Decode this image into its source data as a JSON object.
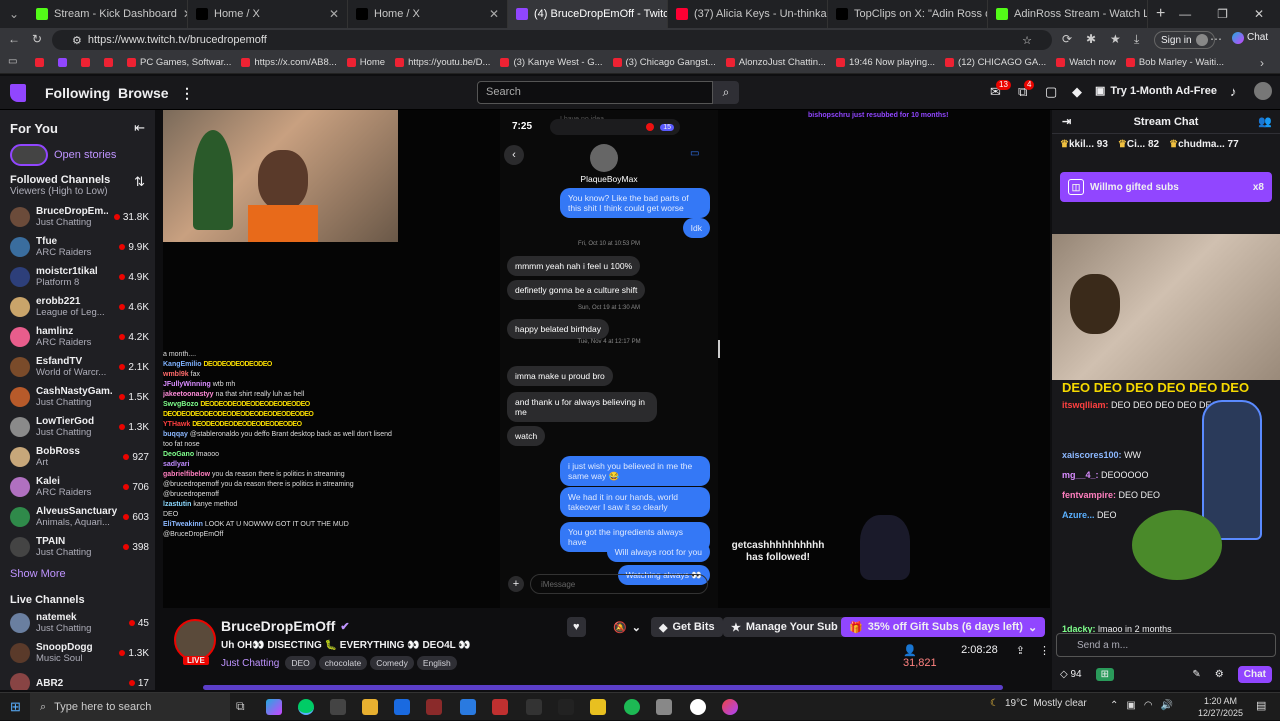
{
  "browser": {
    "tabs": [
      {
        "label": "Stream - Kick Dashboard",
        "color": "#53fc18"
      },
      {
        "label": "Home / X",
        "color": "#000000"
      },
      {
        "label": "Home / X",
        "color": "#000000"
      },
      {
        "label": "(4) BruceDropEmOff - Twitch",
        "color": "#9146ff"
      },
      {
        "label": "(37) Alicia Keys - Un-thinkable (I'm",
        "color": "#ff0033"
      },
      {
        "label": "TopClips on X: \"Adin Ross defends",
        "color": "#000000"
      },
      {
        "label": "AdinRoss Stream - Watch Live on",
        "color": "#53fc18"
      }
    ],
    "url": "https://www.twitch.tv/brucedropemoff",
    "signin": "Sign in",
    "chat_btn": "Chat",
    "bookmarks": [
      "PC Games, Softwar...",
      "https://x.com/AB8...",
      "Home",
      "https://youtu.be/D...",
      "(3) Kanye West - G...",
      "(3) Chicago Gangst...",
      "AlonzoJust Chattin...",
      "19:46 Now playing...",
      "(12) CHICAGO GA...",
      "Watch now",
      "Bob Marley - Waiti..."
    ]
  },
  "twitch": {
    "nav": {
      "following": "Following",
      "browse": "Browse",
      "search_placeholder": "Search",
      "notif1": "13",
      "notif2": "4",
      "adfree": "Try 1-Month Ad-Free"
    },
    "sidebar": {
      "for_you": "For You",
      "open_stories": "Open stories",
      "followed_title": "Followed Channels",
      "followed_sub": "Viewers (High to Low)",
      "channels": [
        {
          "name": "BruceDropEm...",
          "cat": "Just Chatting",
          "viewers": "31.8K",
          "color": "#6b4b3a"
        },
        {
          "name": "Tfue",
          "cat": "ARC Raiders",
          "viewers": "9.9K",
          "color": "#3a6d9e"
        },
        {
          "name": "moistcr1tikal",
          "cat": "Platform 8",
          "viewers": "4.9K",
          "color": "#2d3f7a"
        },
        {
          "name": "erobb221",
          "cat": "League of Leg...",
          "viewers": "4.6K",
          "color": "#c9a46a"
        },
        {
          "name": "hamlinz",
          "cat": "ARC Raiders",
          "viewers": "4.2K",
          "color": "#e85d8c"
        },
        {
          "name": "EsfandTV",
          "cat": "World of Warcr...",
          "viewers": "2.1K",
          "color": "#7a4b2a"
        },
        {
          "name": "CashNastyGam...",
          "cat": "Just Chatting",
          "viewers": "1.5K",
          "color": "#b75a2a"
        },
        {
          "name": "LowTierGod",
          "cat": "Just Chatting",
          "viewers": "1.3K",
          "color": "#8a8a8a"
        },
        {
          "name": "BobRoss",
          "cat": "Art",
          "viewers": "927",
          "color": "#c7a77a"
        },
        {
          "name": "Kalei",
          "cat": "ARC Raiders",
          "viewers": "706",
          "color": "#b070c0"
        },
        {
          "name": "AlveusSanctuary",
          "cat": "Animals, Aquari...",
          "viewers": "603",
          "color": "#2f8a4a"
        },
        {
          "name": "TPAIN",
          "cat": "Just Chatting",
          "viewers": "398",
          "color": "#444444"
        }
      ],
      "show_more": "Show More",
      "live_title": "Live Channels",
      "live": [
        {
          "name": "natemek",
          "cat": "Just Chatting",
          "viewers": "45",
          "color": "#6a7fa0"
        },
        {
          "name": "SnoopDogg",
          "cat": "Music Soul",
          "viewers": "1.3K",
          "color": "#5a3a2a"
        },
        {
          "name": "ABR2",
          "cat": "",
          "viewers": "17",
          "color": "#884444"
        }
      ]
    },
    "video": {
      "overlay_chat": [
        {
          "user": "",
          "msg": "a month....",
          "c": "#ddd"
        },
        {
          "user": "KangEmilio",
          "msg": "DEODEODEODEODEO",
          "c": "#7fb2ff",
          "deo": true
        },
        {
          "user": "wmbl9k",
          "msg": "fax",
          "c": "#ff6b6b"
        },
        {
          "user": "JFullyWinning",
          "msg": "wtb mh",
          "c": "#d98cff"
        },
        {
          "user": "jakeetoonastyy",
          "msg": "na that shirt really luh as hell",
          "c": "#ff8cd9"
        },
        {
          "user": "SwvgBozo",
          "msg": "DEODEODEODEODEODEODEODEO",
          "c": "#7fff8c",
          "deo": true
        },
        {
          "user": "",
          "msg": "DEODEODEODEODEODEODEODEODEODEODEO",
          "c": "#ddd",
          "deo": true
        },
        {
          "user": "YTHawk",
          "msg": "DEODEODEODEODEODEODEODEO",
          "c": "#ff4040",
          "deo": true
        },
        {
          "user": "buqqay",
          "msg": "@stableronaldo you deffo Brant desktop back as well don't lisend too fat nose",
          "c": "#8cb8ff"
        },
        {
          "user": "DeoGano",
          "msg": "lmaooo",
          "c": "#7fff8c"
        },
        {
          "user": "sadlyari",
          "msg": "",
          "c": "#c08cff"
        },
        {
          "user": "gabrielfibelow",
          "msg": "you da reason there is politics in streaming @brucedropemoff you da reason there is politics in streaming @brucedropemoff",
          "c": "#ff7fbf"
        },
        {
          "user": "lzastutin",
          "msg": "kanye method",
          "c": "#8cd9ff"
        },
        {
          "user": "",
          "msg": "DEO",
          "c": "#ddd"
        },
        {
          "user": "EliTweakinn",
          "msg": "LOOK AT U NOWWW GOT IT OUT THE MUD @BruceDropEmOff",
          "c": "#8cb8ff"
        }
      ],
      "phone": {
        "time": "7:25",
        "contact": "PlaqueBoyMax",
        "top_faded": "I have no idea",
        "badge": "15",
        "messages": [
          {
            "t": "You know? Like the bad parts of this shit I think could get worse",
            "dir": "out"
          },
          {
            "t": "Idk",
            "dir": "out"
          },
          {
            "t": "Fri, Oct 10 at 10:53 PM",
            "dir": "ts"
          },
          {
            "t": "mmmm yeah nah i feel u 100%",
            "dir": "in"
          },
          {
            "t": "definetly gonna be a culture shift",
            "dir": "in"
          },
          {
            "t": "Sun, Oct 19 at 1:30 AM",
            "dir": "ts"
          },
          {
            "t": "happy belated birthday",
            "dir": "in"
          },
          {
            "t": "Tue, Nov 4 at 12:17 PM",
            "dir": "ts"
          },
          {
            "t": "imma make u proud bro",
            "dir": "in"
          },
          {
            "t": "and thank u for always believing in me",
            "dir": "in"
          },
          {
            "t": "watch",
            "dir": "in"
          },
          {
            "t": "i just wish you believed in me the same way 😂",
            "dir": "out"
          },
          {
            "t": "We had it in our hands, world takeover I saw it so clearly",
            "dir": "out"
          },
          {
            "t": "You got the ingredients always have",
            "dir": "out"
          },
          {
            "t": "Will always root for you",
            "dir": "out"
          },
          {
            "t": "Watching always 👀",
            "dir": "out"
          }
        ],
        "imessage": "iMessage"
      },
      "resub": "bishopschru just resubbed for 10 months!",
      "followed": "getcashhhhhhhhhh has followed!"
    },
    "stream": {
      "channel": "BruceDropEmOff",
      "title": "Uh OH👀 DISECTING 🐛 EVERYTHING 👀 DEO4L 👀",
      "category": "Just Chatting",
      "tags": [
        "DEO",
        "chocolate",
        "Comedy",
        "English"
      ],
      "live": "LIVE",
      "viewers": "31,821",
      "uptime": "2:08:28",
      "get_bits": "Get Bits",
      "manage_sub": "Manage Your Sub",
      "gift": "35% off Gift Subs (6 days left)"
    },
    "chat": {
      "title": "Stream Chat",
      "leaders": [
        {
          "n": "kkil...",
          "v": "93"
        },
        {
          "n": "Ci...",
          "v": "82"
        },
        {
          "n": "chudma...",
          "v": "77"
        }
      ],
      "gift_banner": "Willmo gifted subs",
      "gift_count": "x8",
      "lines": [
        {
          "user": "",
          "msg": "DEO DEO DEO DEO DEO DEO",
          "c": "#f5d900"
        },
        {
          "user": "itswqlliam:",
          "msg": "DEO DEO DEO DEO DEO",
          "c": "#ff4040"
        },
        {
          "user": "xaiscores100:",
          "msg": "WW",
          "c": "#8cb8ff"
        },
        {
          "user": "mg__4_:",
          "msg": "DEOOOOO",
          "c": "#d98cff"
        },
        {
          "user": "fentvampire:",
          "msg": "DEO DEO",
          "c": "#ff7fbf"
        },
        {
          "user": "Azure...",
          "msg": "DEO",
          "c": "#5ab0ff"
        },
        {
          "user": "1dacky:",
          "msg": "lmaoo in 2 months",
          "c": "#7fff8c"
        }
      ],
      "send": "Send a m...",
      "points": "94",
      "chat_btn": "Chat"
    }
  },
  "taskbar": {
    "search": "Type here to search",
    "weather": "19°C",
    "weather_desc": "Mostly clear",
    "time": "1:20 AM",
    "date": "12/27/2025"
  }
}
